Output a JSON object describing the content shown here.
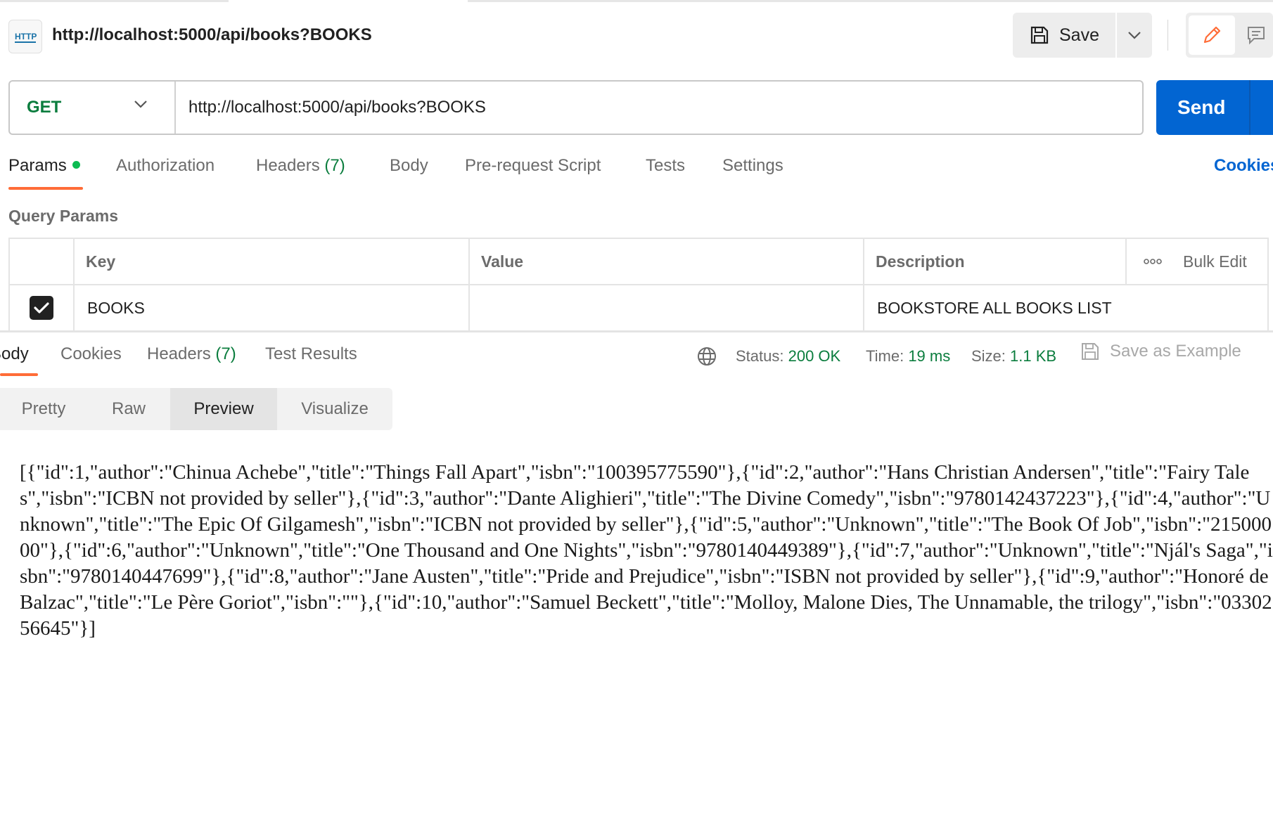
{
  "header": {
    "icon": "http-icon",
    "icon_text": "HTTP",
    "title": "http://localhost:5000/api/books?BOOKS",
    "save_label": "Save"
  },
  "request": {
    "method": "GET",
    "url": "http://localhost:5000/api/books?BOOKS",
    "send_label": "Send"
  },
  "request_tabs": [
    {
      "label": "Params",
      "active": true
    },
    {
      "label": "Authorization"
    },
    {
      "label": "Headers",
      "count": "(7)"
    },
    {
      "label": "Body"
    },
    {
      "label": "Pre-request Script"
    },
    {
      "label": "Tests"
    },
    {
      "label": "Settings"
    }
  ],
  "cookies_link": "Cookies",
  "query_params": {
    "title": "Query Params",
    "columns": {
      "key": "Key",
      "value": "Value",
      "description": "Description"
    },
    "bulk_edit": "Bulk Edit",
    "rows": [
      {
        "checked": true,
        "key": "BOOKS",
        "value": "",
        "description": "BOOKSTORE ALL BOOKS LIST"
      }
    ]
  },
  "response_tabs": [
    {
      "label": "Body",
      "active": true
    },
    {
      "label": "Cookies"
    },
    {
      "label": "Headers",
      "count": "(7)"
    },
    {
      "label": "Test Results"
    }
  ],
  "response_meta": {
    "status_label": "Status:",
    "status_value": "200 OK",
    "time_label": "Time:",
    "time_value": "19 ms",
    "size_label": "Size:",
    "size_value": "1.1 KB",
    "save_example": "Save as Example"
  },
  "view_modes": [
    {
      "label": "Pretty"
    },
    {
      "label": "Raw"
    },
    {
      "label": "Preview",
      "active": true
    },
    {
      "label": "Visualize"
    }
  ],
  "response_body": "[{\"id\":1,\"author\":\"Chinua Achebe\",\"title\":\"Things Fall Apart\",\"isbn\":\"100395775590\"},{\"id\":2,\"author\":\"Hans Christian Andersen\",\"title\":\"Fairy Tales\",\"isbn\":\"ICBN not provided by seller\"},{\"id\":3,\"author\":\"Dante Alighieri\",\"title\":\"The Divine Comedy\",\"isbn\":\"9780142437223\"},{\"id\":4,\"author\":\"Unknown\",\"title\":\"The Epic Of Gilgamesh\",\"isbn\":\"ICBN not provided by seller\"},{\"id\":5,\"author\":\"Unknown\",\"title\":\"The Book Of Job\",\"isbn\":\"21500000\"},{\"id\":6,\"author\":\"Unknown\",\"title\":\"One Thousand and One Nights\",\"isbn\":\"9780140449389\"},{\"id\":7,\"author\":\"Unknown\",\"title\":\"Njál's Saga\",\"isbn\":\"9780140447699\"},{\"id\":8,\"author\":\"Jane Austen\",\"title\":\"Pride and Prejudice\",\"isbn\":\"ISBN not provided by seller\"},{\"id\":9,\"author\":\"Honoré de Balzac\",\"title\":\"Le Père Goriot\",\"isbn\":\"\"},{\"id\":10,\"author\":\"Samuel Beckett\",\"title\":\"Molloy, Malone Dies, The Unnamable, the trilogy\",\"isbn\":\"0330256645\"}]",
  "colors": {
    "accent_orange": "#ff6c37",
    "send_blue": "#0265d2",
    "method_green": "#0b7d3e",
    "status_green": "#0b7d3e"
  }
}
